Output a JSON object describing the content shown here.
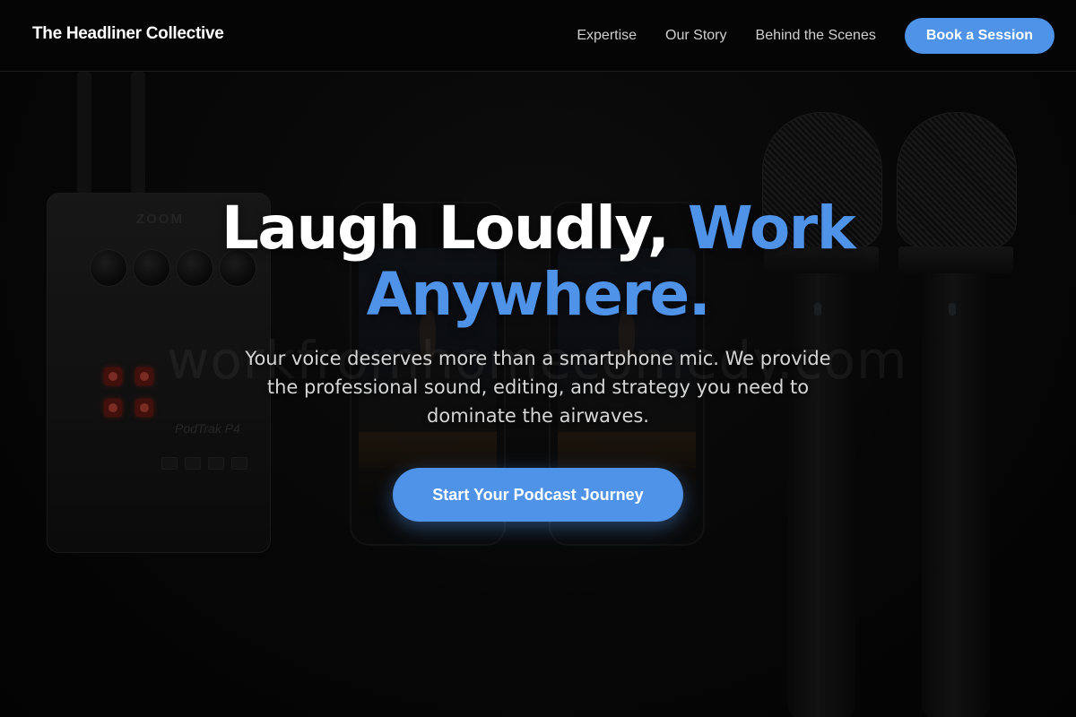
{
  "header": {
    "brand": "The Headliner Collective",
    "nav": [
      {
        "label": "Expertise"
      },
      {
        "label": "Our Story"
      },
      {
        "label": "Behind the Scenes"
      }
    ],
    "cta_label": "Book a Session"
  },
  "hero": {
    "title_part1": "Laugh Loudly, ",
    "title_accent": "Work Anywhere.",
    "subtitle": "Your voice deserves more than a smartphone mic. We provide the professional sound, editing, and strategy you need to dominate the airwaves.",
    "cta_label": "Start Your Podcast Journey"
  },
  "background": {
    "watermark": "workfromhomecomedy.com",
    "recorder_brand": "ZOOM",
    "recorder_model": "PodTrak P4"
  },
  "colors": {
    "accent": "#4f93e8",
    "background": "#080808",
    "header_bg": "#050505",
    "text": "#ffffff"
  }
}
